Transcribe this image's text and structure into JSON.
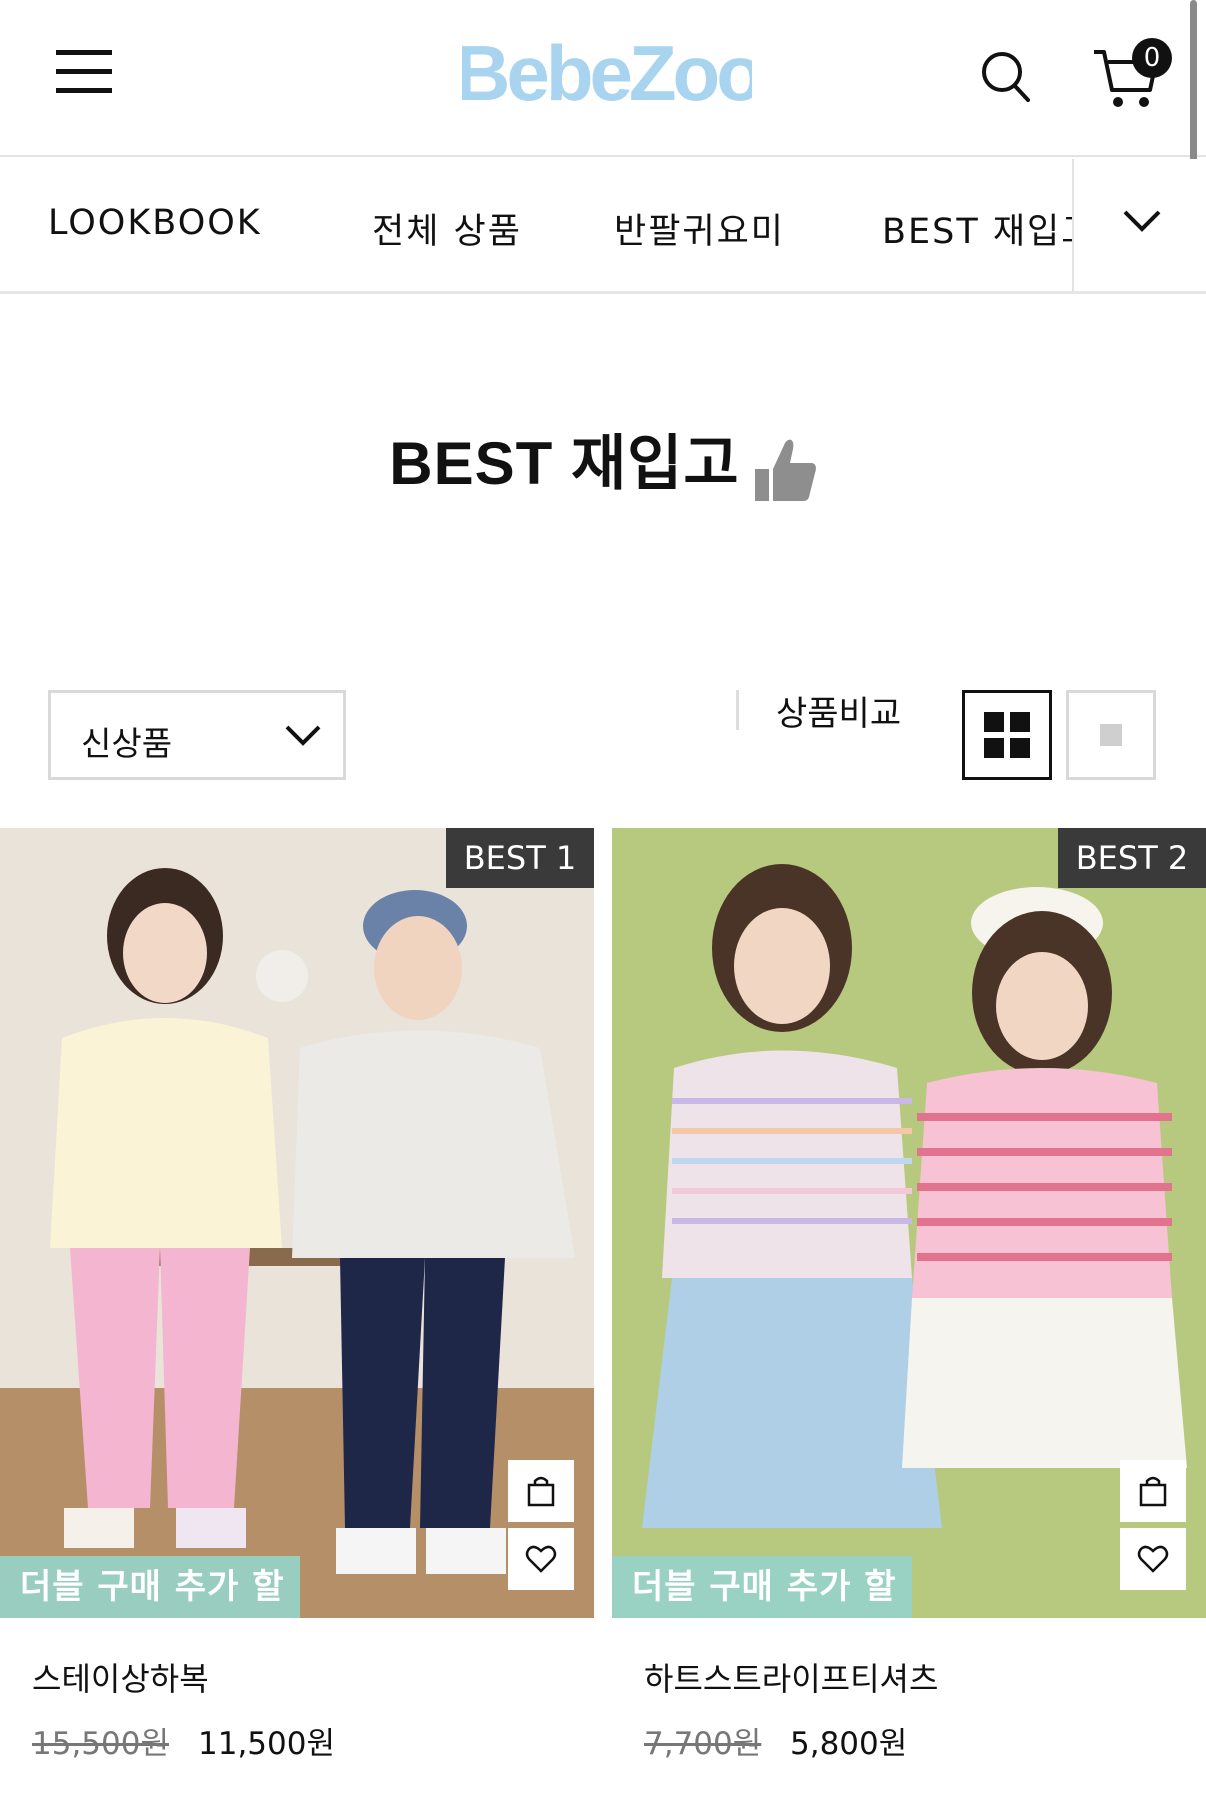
{
  "header": {
    "logo_text": "BebeZoo",
    "cart_count": "0"
  },
  "nav": {
    "items": [
      "LOOKBOOK",
      "전체 상품",
      "반팔귀요미",
      "BEST 재입고"
    ]
  },
  "page": {
    "title": "BEST 재입고"
  },
  "toolbar": {
    "sort_selected": "신상품",
    "compare_label": "상품비교"
  },
  "products": [
    {
      "rank": "BEST 1",
      "promo": "더블 구매 추가 할인",
      "name": "스테이상하복",
      "original_price": "15,500원",
      "price": "11,500원"
    },
    {
      "rank": "BEST 2",
      "promo": "더블 구매 추가 할인",
      "name": "하트스트라이프티셔츠",
      "original_price": "7,700원",
      "price": "5,800원"
    }
  ],
  "colors": {
    "logo": "#a9d4f0",
    "promo": "#96d2c8",
    "rank_badge": "#3a3a3a",
    "photo1_bg": "#e9e3da",
    "photo2_bg": "#b7c97e"
  }
}
